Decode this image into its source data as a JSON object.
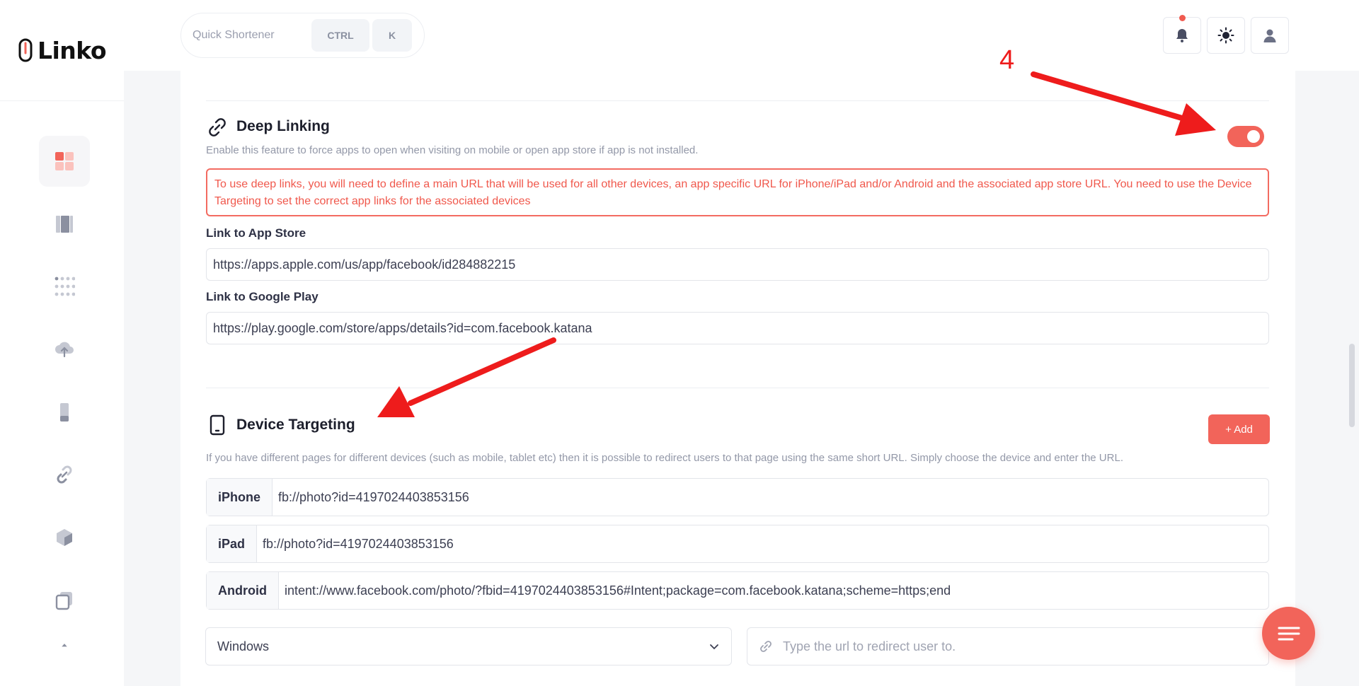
{
  "brand": {
    "name": "Linko"
  },
  "header": {
    "quick_shortener": "Quick Shortener",
    "kbd_ctrl": "CTRL",
    "kbd_k": "K"
  },
  "deep_linking": {
    "title": "Deep Linking",
    "description": "Enable this feature to force apps to open when visiting on mobile or open app store if app is not installed.",
    "enabled": true,
    "alert": "To use deep links, you will need to define a main URL that will be used for all other devices, an app specific URL for iPhone/iPad and/or Android and the associated app store URL. You need to use the Device Targeting to set the correct app links for the associated devices",
    "app_store_label": "Link to App Store",
    "app_store_value": "https://apps.apple.com/us/app/facebook/id284882215",
    "google_play_label": "Link to Google Play",
    "google_play_value": "https://play.google.com/store/apps/details?id=com.facebook.katana"
  },
  "device_targeting": {
    "title": "Device Targeting",
    "add_label": "+ Add",
    "description": "If you have different pages for different devices (such as mobile, tablet etc) then it is possible to redirect users to that page using the same short URL. Simply choose the device and enter the URL.",
    "rows": [
      {
        "device": "iPhone",
        "url": "fb://photo?id=4197024403853156"
      },
      {
        "device": "iPad",
        "url": "fb://photo?id=4197024403853156"
      },
      {
        "device": "Android",
        "url": "intent://www.facebook.com/photo/?fbid=4197024403853156#Intent;package=com.facebook.katana;scheme=https;end"
      }
    ],
    "select_value": "Windows",
    "url_placeholder": "Type the url to redirect user to."
  },
  "annotation": {
    "step": "4"
  },
  "colors": {
    "accent": "#f2645a",
    "annotation": "#ee1c1c"
  }
}
